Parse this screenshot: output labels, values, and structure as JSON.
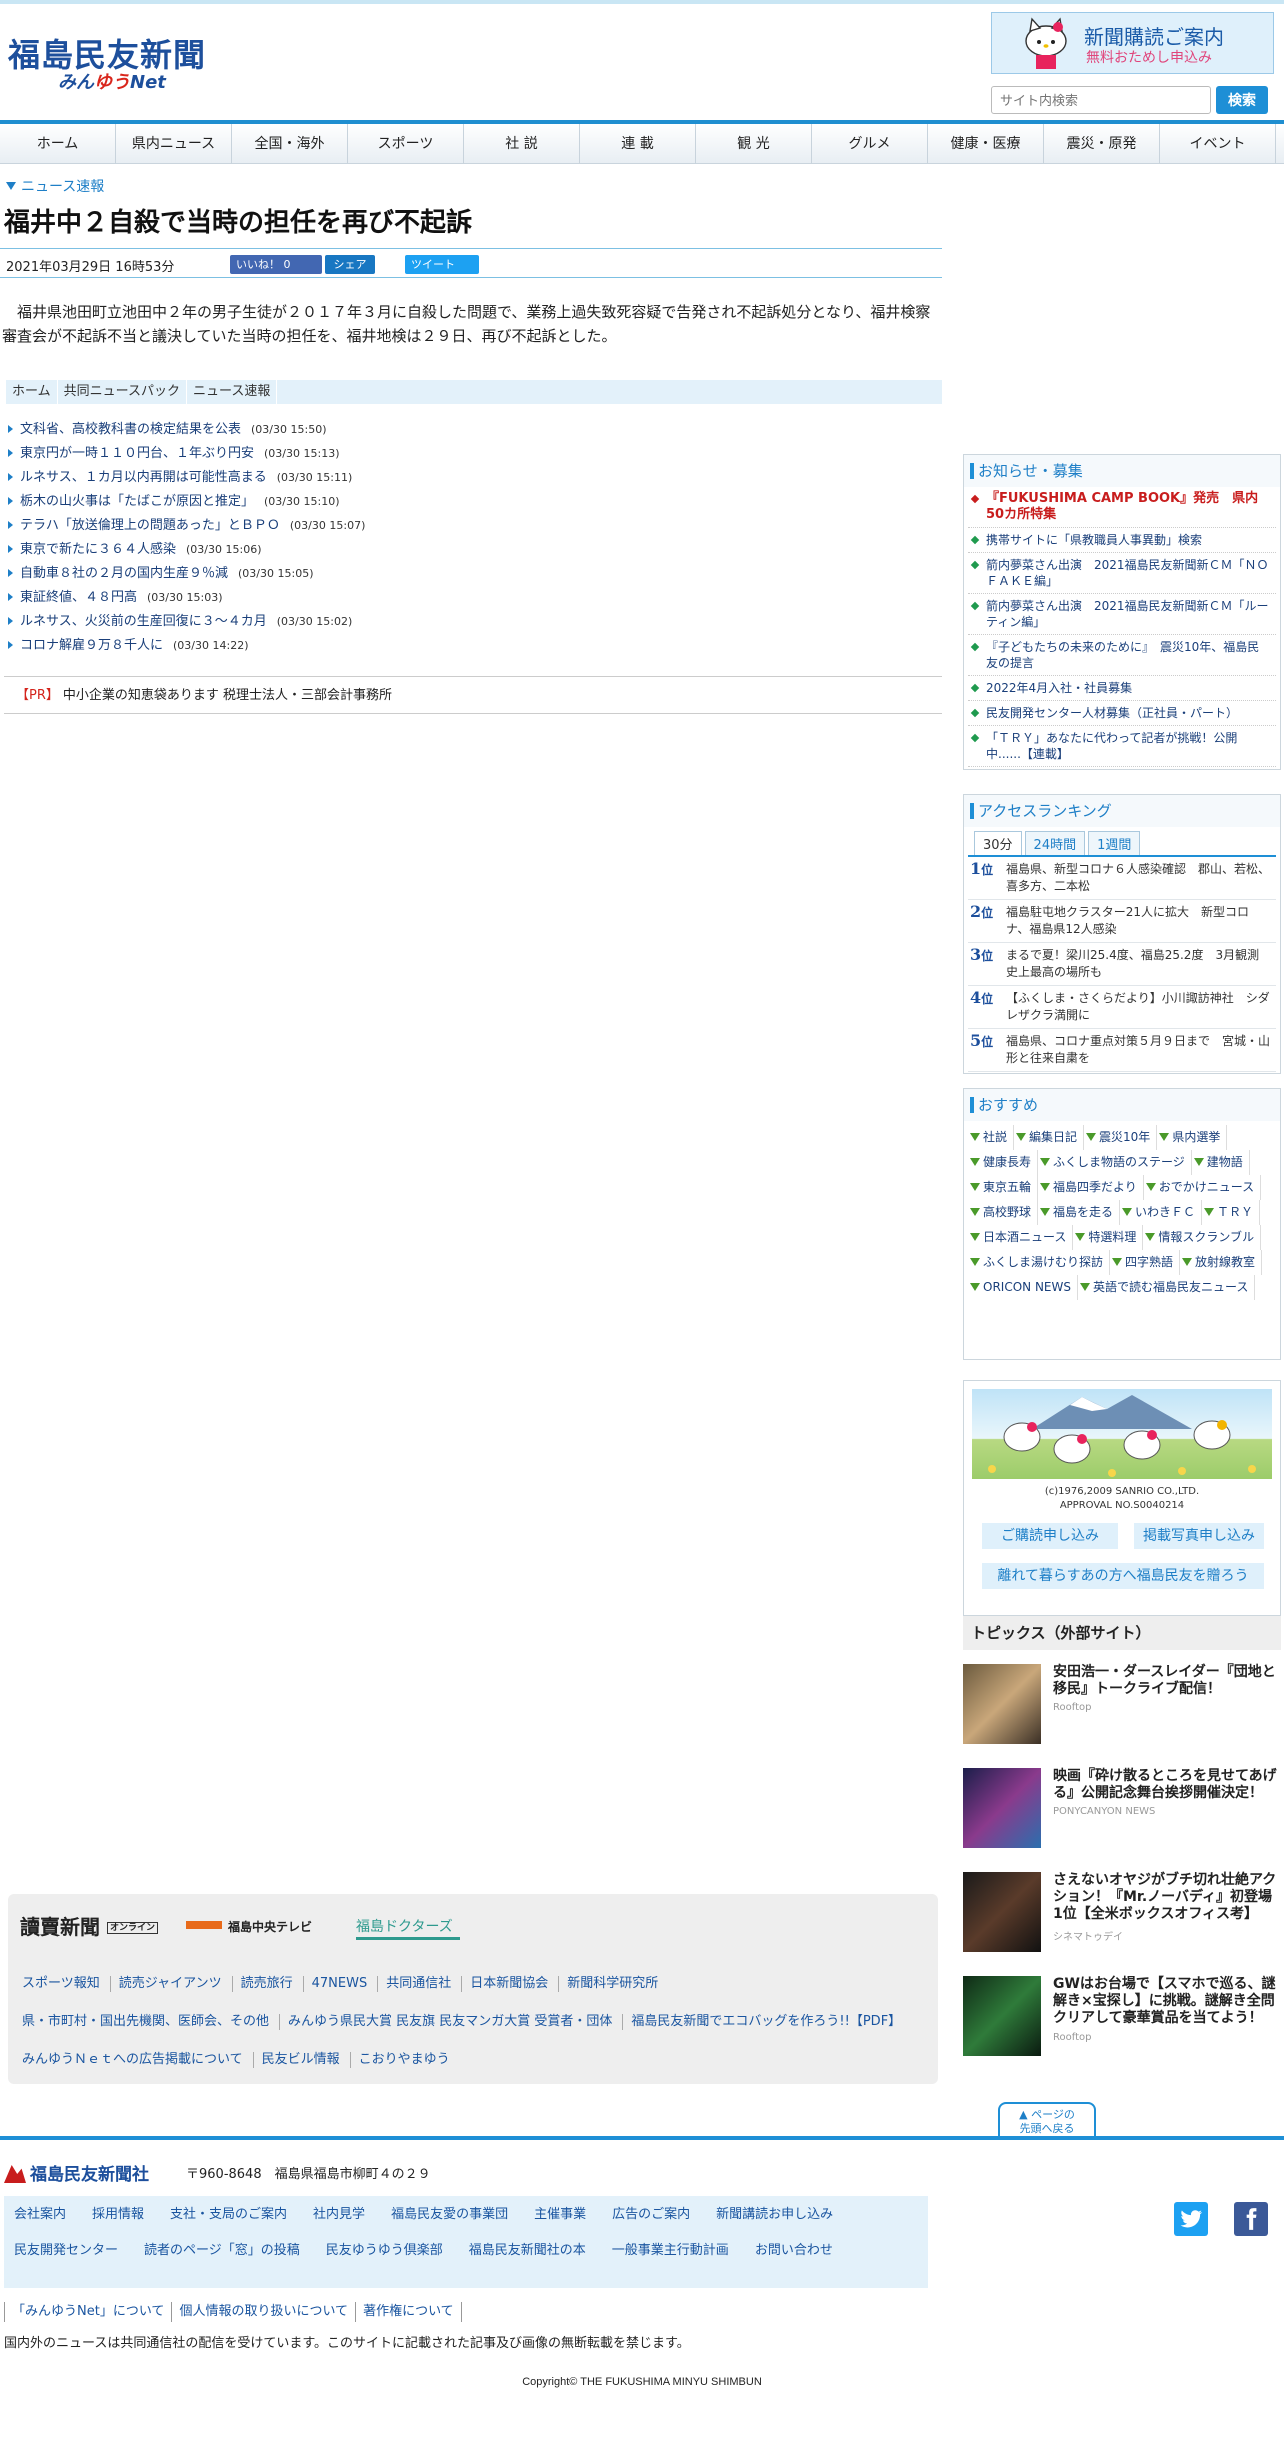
{
  "header": {
    "logo_main": "福島民友新聞",
    "logo_sub_a": "みん",
    "logo_sub_b": "ゆう",
    "logo_sub_c": "Net",
    "promo_title": "新聞購読ご案内",
    "promo_sub": "無料おためし申込み",
    "search_placeholder": "サイト内検索",
    "search_button": "検索"
  },
  "nav": [
    "ホーム",
    "県内ニュース",
    "全国・海外",
    "スポーツ",
    "社 説",
    "連 載",
    "観 光",
    "グルメ",
    "健康・医療",
    "震災・原発",
    "イベント"
  ],
  "article": {
    "breadcrumb": "ニュース速報",
    "title": "福井中２自殺で当時の担任を再び不起訴",
    "datetime": "2021年03月29日 16時53分",
    "like_label": "いいね！ 0",
    "share_label": "シェア",
    "tweet_label": "ツイート",
    "body": "福井県池田町立池田中２年の男子生徒が２０１７年３月に自殺した問題で、業務上過失致死容疑で告発され不起訴処分となり、福井検察審査会が不起訴不当と議決していた当時の担任を、福井地検は２９日、再び不起訴とした。"
  },
  "tagbar": [
    "ホーム",
    "共同ニュースパック",
    "ニュース速報"
  ],
  "news": [
    {
      "title": "文科省、高校教科書の検定結果を公表",
      "time": "(03/30 15:50)"
    },
    {
      "title": "東京円が一時１１０円台、１年ぶり円安",
      "time": "(03/30 15:13)"
    },
    {
      "title": "ルネサス、１カ月以内再開は可能性高まる",
      "time": "(03/30 15:11)"
    },
    {
      "title": "栃木の山火事は「たばこが原因と推定」",
      "time": "(03/30 15:10)"
    },
    {
      "title": "テラハ「放送倫理上の問題あった」とＢＰＯ",
      "time": "(03/30 15:07)"
    },
    {
      "title": "東京で新たに３６４人感染",
      "time": "(03/30 15:06)"
    },
    {
      "title": "自動車８社の２月の国内生産９％減",
      "time": "(03/30 15:05)"
    },
    {
      "title": "東証終値、４８円高",
      "time": "(03/30 15:03)"
    },
    {
      "title": "ルネサス、火災前の生産回復に３～４カ月",
      "time": "(03/30 15:02)"
    },
    {
      "title": "コロナ解雇９万８千人に",
      "time": "(03/30 14:22)"
    }
  ],
  "pr": {
    "tag": "【PR】",
    "text": "中小企業の知恵袋あります 税理士法人・三部会計事務所"
  },
  "sidebar": {
    "notice_title": "お知らせ・募集",
    "notices": [
      "『FUKUSHIMA CAMP BOOK』発売　県内50カ所特集",
      "携帯サイトに「県教職員人事異動」検索",
      "箭内夢菜さん出演　2021福島民友新聞新ＣＭ「ＮＯＦＡＫＥ編」",
      "箭内夢菜さん出演　2021福島民友新聞新ＣＭ「ルーティン編」",
      "『子どもたちの未来のために』　震災10年、福島民友の提言",
      "2022年4月入社・社員募集",
      "民友開発センター人材募集（正社員・パート）",
      "「ＴＲＹ」あなたに代わって記者が挑戦！公開中......【連載】"
    ],
    "ranking_title": "アクセスランキング",
    "ranking_tabs": [
      "30分",
      "24時間",
      "1週間"
    ],
    "rank_suffix": "位",
    "ranking": [
      {
        "rank": "1",
        "text": "福島県、新型コロナ６人感染確認　郡山、若松、喜多方、二本松"
      },
      {
        "rank": "2",
        "text": "福島駐屯地クラスター21人に拡大　新型コロナ、福島県12人感染"
      },
      {
        "rank": "3",
        "text": "まるで夏！梁川25.4度、福島25.2度　3月観測史上最高の場所も"
      },
      {
        "rank": "4",
        "text": "【ふくしま・さくらだより】小川諏訪神社　シダレザクラ満開に"
      },
      {
        "rank": "5",
        "text": "福島県、コロナ重点対策５月９日まで　宮城・山形と往来自粛を"
      }
    ],
    "reco_title": "おすすめ",
    "reco": [
      "社説",
      "編集日記",
      "震災10年",
      "県内選挙",
      "健康長寿",
      "ふくしま物語のステージ",
      "建物語",
      "東京五輪",
      "福島四季だより",
      "おでかけニュース",
      "高校野球",
      "福島を走る",
      "いわきＦＣ",
      "ＴＲＹ",
      "日本酒ニュース",
      "特選料理",
      "情報スクランブル",
      "ふくしま湯けむり探訪",
      "四字熟語",
      "放射線教室",
      "ORICON NEWS",
      "英語で読む福島民友ニュース"
    ],
    "kitty_copy1": "(c)1976,2009 SANRIO CO.,LTD.",
    "kitty_copy2": "APPROVAL NO.S0040214",
    "kitty_btn1": "ご購読申し込み",
    "kitty_btn2": "掲載写真申し込み",
    "kitty_btn3": "離れて暮らすあの方へ福島民友を贈ろう",
    "topics_title": "トピックス（外部サイト）",
    "topics": [
      {
        "title": "安田浩一・ダースレイダー『団地と移民』トークライブ配信！",
        "src": "Rooftop"
      },
      {
        "title": "映画『砕け散るところを見せてあげる』公開記念舞台挨拶開催決定！",
        "src": "PONYCANYON NEWS"
      },
      {
        "title": "さえないオヤジがブチ切れ壮絶アクション！『Mr.ノーバディ』初登場1位【全米ボックスオフィス考】",
        "src": "シネマトゥデイ"
      },
      {
        "title": "GWはお台場で【スマホで巡る、謎解き×宝探し】に挑戦。謎解き全問クリアして豪華賞品を当てよう！",
        "src": "Rooftop"
      }
    ]
  },
  "partners": {
    "logo1": "讀賣新聞",
    "logo1_badge": "オンライン",
    "logo2": "福島中央テレビ",
    "logo3": "福島ドクターズ",
    "row1": [
      "スポーツ報知",
      "読売ジャイアンツ",
      "読売旅行",
      "47NEWS",
      "共同通信社",
      "日本新聞協会",
      "新聞科学研究所"
    ],
    "row2": [
      "県・市町村・国出先機関、医師会、その他",
      "みんゆう県民大賞 民友旗 民友マンガ大賞 受賞者・団体",
      "福島民友新聞でエコバッグを作ろう!!【PDF】"
    ],
    "row3": [
      "みんゆうＮｅｔへの広告掲載について",
      "民友ビル情報",
      "こおりやまゆう"
    ]
  },
  "footer": {
    "pagetop1": "ページの",
    "pagetop2": "先頭へ戻る",
    "company": "福島民友新聞社",
    "address": "〒960-8648　福島県福島市柳町４の２９",
    "nav1": [
      "会社案内",
      "採用情報",
      "支社・支局のご案内",
      "社内見学",
      "福島民友愛の事業団",
      "主催事業",
      "広告のご案内",
      "新聞講読お申し込み"
    ],
    "nav2": [
      "民友開発センター",
      "読者のページ「窓」の投稿",
      "民友ゆうゆう倶楽部",
      "福島民友新聞社の本",
      "一般事業主行動計画",
      "お問い合わせ"
    ],
    "links": [
      "「みんゆうNet」について",
      "個人情報の取り扱いについて",
      "著作権について"
    ],
    "note": "国内外のニュースは共同通信社の配信を受けています。このサイトに記載された記事及び画像の無断転載を禁じます。",
    "copyright": "Copyright© THE FUKUSHIMA MINYU SHIMBUN"
  },
  "colors": {
    "accent": "#1e8fd6",
    "brand": "#1d4f9c",
    "alert": "#c81d1d"
  }
}
